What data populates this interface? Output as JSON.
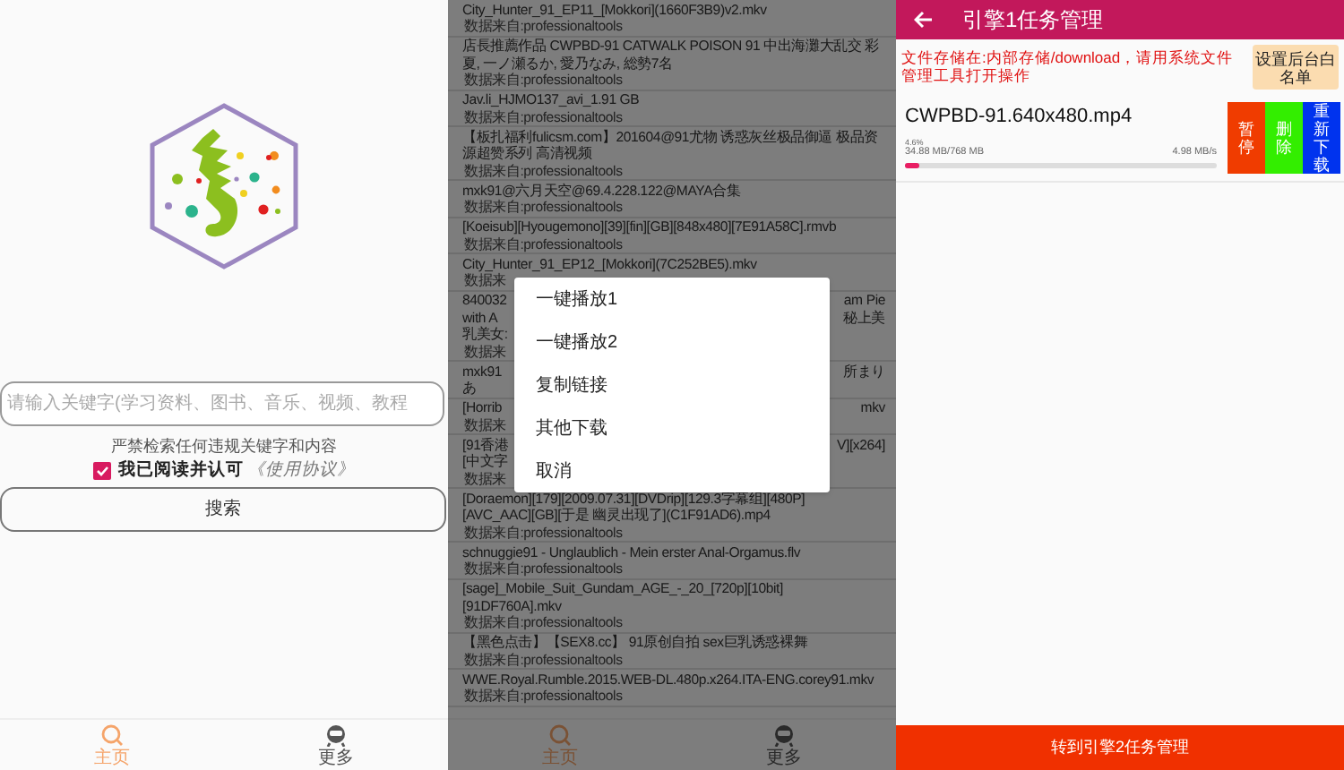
{
  "home": {
    "search": {
      "placeholder": "请输入关键字(学习资料、图书、音乐、视频、教程"
    },
    "notice": "严禁检索任何违规关键字和内容",
    "agreement": {
      "checked": true,
      "text": "我已阅读并认可",
      "link": "《使用协议》"
    },
    "search_button": "搜索",
    "nav": [
      {
        "label": "主页",
        "selected": true,
        "kind": "search"
      },
      {
        "label": "更多",
        "selected": false,
        "kind": "robot"
      }
    ]
  },
  "results": {
    "rows": [
      {
        "lines": [
          {
            "kind": "title",
            "text": "City_Hunter_91_EP11_[Mokkori](1660F3B9)v2.mkv"
          },
          {
            "kind": "source",
            "text": "数据来自:professionaltools"
          }
        ]
      },
      {
        "lines": [
          {
            "kind": "title",
            "text": "店長推薦作品 CWPBD-91 CATWALK POISON 91 中出海灘大乱交 彩"
          },
          {
            "kind": "title",
            "text": "夏, 一ノ瀬るか, 愛乃なみ, 総勢7名"
          },
          {
            "kind": "source",
            "text": "数据来自:professionaltools"
          }
        ]
      },
      {
        "lines": [
          {
            "kind": "title",
            "text": "Jav.li_HJMO137_avi_1.91 GB"
          },
          {
            "kind": "source",
            "text": "数据来自:professionaltools"
          }
        ]
      },
      {
        "lines": [
          {
            "kind": "title",
            "text": "【板扎福利fulicsm.com】201604@91尤物 诱惑灰丝极品御逼 极品资"
          },
          {
            "kind": "title",
            "text": "源超赞系列 高清视频"
          },
          {
            "kind": "source",
            "text": "数据来自:professionaltools"
          }
        ]
      },
      {
        "lines": [
          {
            "kind": "title",
            "text": "mxk91@六月天空@69.4.228.122@MAYA合集"
          },
          {
            "kind": "source",
            "text": "数据来自:professionaltools"
          }
        ]
      },
      {
        "lines": [
          {
            "kind": "title",
            "text": "[Koeisub][Hyougemono][39][fin][GB][848x480][7E91A58C].rmvb"
          },
          {
            "kind": "source",
            "text": "数据来自:professionaltools"
          }
        ]
      },
      {
        "lines": [
          {
            "kind": "title",
            "text": "City_Hunter_91_EP12_[Mokkori](7C252BE5).mkv"
          },
          {
            "kind": "source",
            "text": "数据来"
          }
        ]
      },
      {
        "lines": [
          {
            "kind": "title",
            "text": "840032",
            "right": "am Pie"
          },
          {
            "kind": "title",
            "text": "with A",
            "right": "秘上美"
          },
          {
            "kind": "title",
            "text": "乳美女:"
          },
          {
            "kind": "source",
            "text": "数据来"
          }
        ]
      },
      {
        "lines": [
          {
            "kind": "title",
            "text": "mxk91",
            "right": "所まり"
          },
          {
            "kind": "title",
            "text": "あ"
          }
        ]
      },
      {
        "lines": [
          {
            "kind": "title",
            "text": "[Horrib",
            "right": "mkv"
          },
          {
            "kind": "source",
            "text": "数据来"
          }
        ]
      },
      {
        "lines": [
          {
            "kind": "title",
            "text": "[91香港",
            "right": "V][x264]"
          },
          {
            "kind": "title",
            "text": "[中文字"
          },
          {
            "kind": "source",
            "text": "数据来"
          }
        ]
      },
      {
        "lines": [
          {
            "kind": "title",
            "text": "[Doraemon][179][2009.07.31][DVDrip][129.3字幕组][480P]"
          },
          {
            "kind": "title",
            "text": "[AVC_AAC][GB][于是 幽灵出现了](C1F91AD6).mp4"
          },
          {
            "kind": "source",
            "text": "数据来自:professionaltools"
          }
        ]
      },
      {
        "lines": [
          {
            "kind": "title",
            "text": "schnuggie91 - Unglaublich - Mein erster Anal-Orgamus.flv"
          },
          {
            "kind": "source",
            "text": "数据来自:professionaltools"
          }
        ]
      },
      {
        "lines": [
          {
            "kind": "title",
            "text": "[sage]_Mobile_Suit_Gundam_AGE_-_20_[720p][10bit]"
          },
          {
            "kind": "title",
            "text": "[91DF760A].mkv"
          },
          {
            "kind": "source",
            "text": "数据来自:professionaltools"
          }
        ]
      },
      {
        "lines": [
          {
            "kind": "title",
            "text": "【黑色点击】【SEX8.cc】 91原创自拍 sex巨乳诱惑裸舞"
          },
          {
            "kind": "source",
            "text": "数据来自:professionaltools"
          }
        ]
      },
      {
        "lines": [
          {
            "kind": "title",
            "text": "WWE.Royal.Rumble.2015.WEB-DL.480p.x264.ITA-ENG.corey91.mkv"
          },
          {
            "kind": "source",
            "text": "数据来自:professionaltools"
          }
        ]
      }
    ],
    "nav": [
      {
        "label": "主页",
        "selected": true,
        "kind": "search"
      },
      {
        "label": "更多",
        "selected": false,
        "kind": "robot"
      }
    ]
  },
  "menu": {
    "items": [
      "一键播放1",
      "一键播放2",
      "复制链接",
      "其他下载",
      "取消"
    ]
  },
  "tasks": {
    "title": "引擎1任务管理",
    "notice": "文件存储在:内部存储/download，请用系统文件管理工具打开操作",
    "whitelist_button": "设置后台白名单",
    "items": [
      {
        "name": "CWPBD-91.640x480.mp4",
        "percent": "4.6%",
        "size": "34.88 MB/768 MB",
        "speed": "4.98 MB/s",
        "level": 0.045,
        "actions": [
          {
            "label": "暂停",
            "color": "#f03c00"
          },
          {
            "label": "删除",
            "color": "#33ee00"
          },
          {
            "label": "重新下载",
            "color": "#0033ee"
          }
        ]
      }
    ]
  },
  "footer_button": "转到引擎2任务管理"
}
